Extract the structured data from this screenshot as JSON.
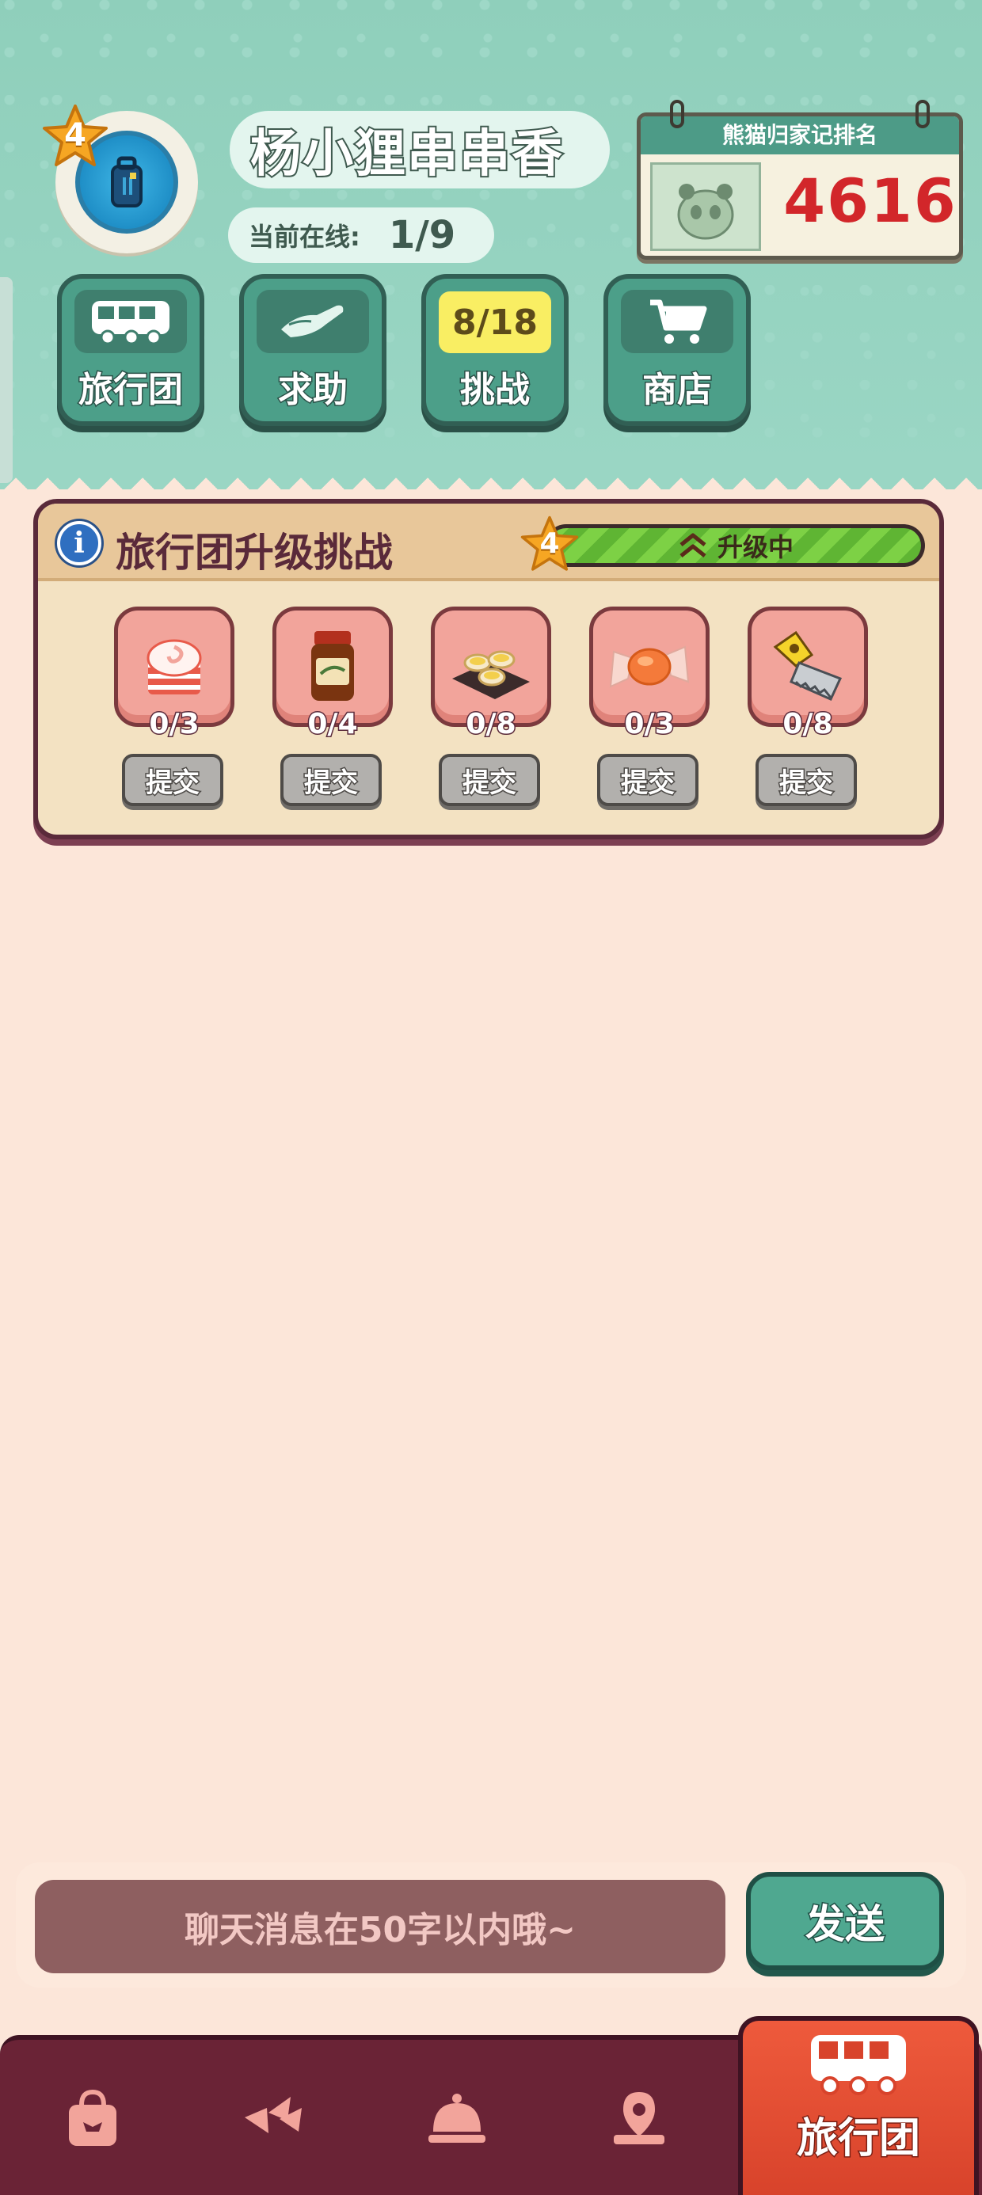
{
  "profile": {
    "level": "4",
    "name": "杨小狸串串香",
    "online_label": "当前在线:",
    "online_value": "1/9"
  },
  "rank": {
    "title": "熊猫归家记排名",
    "value": "4616"
  },
  "toolbar": [
    {
      "label": "旅行团",
      "icon": "bus-icon"
    },
    {
      "label": "求助",
      "icon": "helping-hand-icon"
    },
    {
      "label": "挑战",
      "icon": "challenge-icon",
      "badge": "8/18"
    },
    {
      "label": "商店",
      "icon": "shopping-cart-icon"
    }
  ],
  "challenge": {
    "title": "旅行团升级挑战",
    "level": "4",
    "status": "升级中",
    "progress": 1.0,
    "items": [
      {
        "name": "fish-cake-roll-icon",
        "count": "0/3",
        "submit": "提交"
      },
      {
        "name": "sauce-jar-icon",
        "count": "0/4",
        "submit": "提交"
      },
      {
        "name": "egg-tart-tray-icon",
        "count": "0/8",
        "submit": "提交"
      },
      {
        "name": "candy-wrapper-icon",
        "count": "0/3",
        "submit": "提交"
      },
      {
        "name": "cheese-grater-icon",
        "count": "0/8",
        "submit": "提交"
      }
    ]
  },
  "chat": {
    "placeholder": "聊天消息在50字以内哦~",
    "send": "发送"
  },
  "nav": {
    "items": [
      "shopping-bag-icon",
      "bows-icon",
      "service-bell-icon",
      "map-pin-icon"
    ],
    "active_label": "旅行团",
    "active_icon": "bus-icon"
  },
  "colors": {
    "header_teal": "#9ad6c4",
    "page_bg": "#fce6d9",
    "panel_border": "#5a2a3a",
    "nav_bg": "#6a2336",
    "nav_active": "#ee5a3c",
    "rank_red": "#d2262a",
    "progress_green": "#7dd145"
  }
}
